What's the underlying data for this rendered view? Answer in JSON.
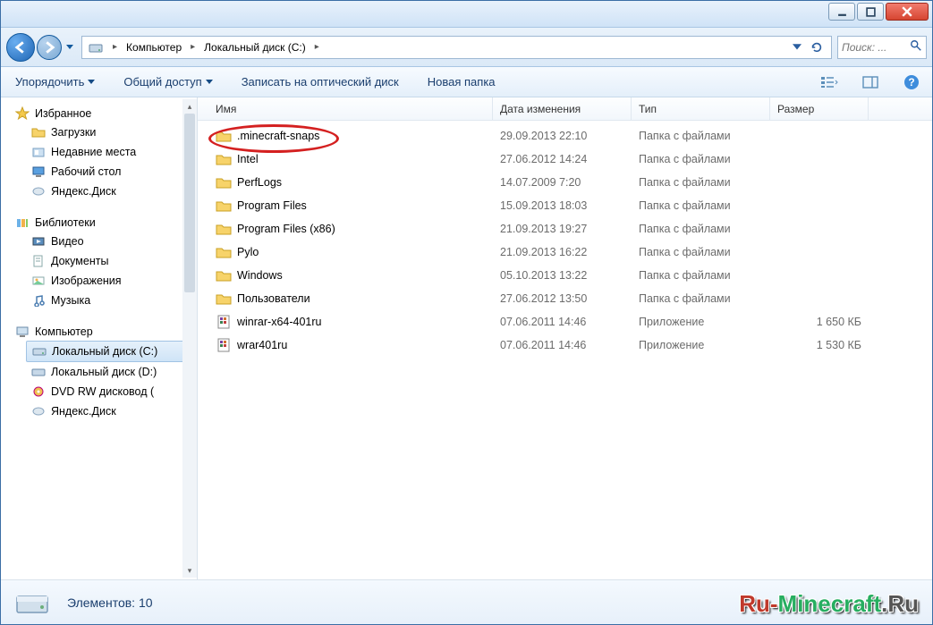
{
  "breadcrumbs": [
    "Компьютер",
    "Локальный диск (C:)"
  ],
  "search": {
    "placeholder": "Поиск: ..."
  },
  "toolbar": {
    "organize": "Упорядочить",
    "share": "Общий доступ",
    "burn": "Записать на оптический диск",
    "new_folder": "Новая папка"
  },
  "columns": {
    "name": "Имя",
    "date": "Дата изменения",
    "type": "Тип",
    "size": "Размер"
  },
  "sidebar": {
    "favorites": {
      "head": "Избранное",
      "items": [
        "Загрузки",
        "Недавние места",
        "Рабочий стол",
        "Яндекс.Диск"
      ]
    },
    "libraries": {
      "head": "Библиотеки",
      "items": [
        "Видео",
        "Документы",
        "Изображения",
        "Музыка"
      ]
    },
    "computer": {
      "head": "Компьютер",
      "items": [
        "Локальный диск (C:)",
        "Локальный диск (D:)",
        "DVD RW дисковод (",
        "Яндекс.Диск"
      ]
    }
  },
  "files": [
    {
      "name": ".minecraft-snaps",
      "date": "29.09.2013 22:10",
      "type": "Папка с файлами",
      "size": "",
      "kind": "folder",
      "highlight": true
    },
    {
      "name": "Intel",
      "date": "27.06.2012 14:24",
      "type": "Папка с файлами",
      "size": "",
      "kind": "folder"
    },
    {
      "name": "PerfLogs",
      "date": "14.07.2009 7:20",
      "type": "Папка с файлами",
      "size": "",
      "kind": "folder"
    },
    {
      "name": "Program Files",
      "date": "15.09.2013 18:03",
      "type": "Папка с файлами",
      "size": "",
      "kind": "folder"
    },
    {
      "name": "Program Files (x86)",
      "date": "21.09.2013 19:27",
      "type": "Папка с файлами",
      "size": "",
      "kind": "folder"
    },
    {
      "name": "Pylo",
      "date": "21.09.2013 16:22",
      "type": "Папка с файлами",
      "size": "",
      "kind": "folder"
    },
    {
      "name": "Windows",
      "date": "05.10.2013 13:22",
      "type": "Папка с файлами",
      "size": "",
      "kind": "folder"
    },
    {
      "name": "Пользователи",
      "date": "27.06.2012 13:50",
      "type": "Папка с файлами",
      "size": "",
      "kind": "folder"
    },
    {
      "name": "winrar-x64-401ru",
      "date": "07.06.2011 14:46",
      "type": "Приложение",
      "size": "1 650 КБ",
      "kind": "exe"
    },
    {
      "name": "wrar401ru",
      "date": "07.06.2011 14:46",
      "type": "Приложение",
      "size": "1 530 КБ",
      "kind": "exe"
    }
  ],
  "status": {
    "label": "Элементов:",
    "count": "10"
  },
  "watermark": {
    "p1": "Ru-",
    "p2": "Minecraft",
    "p3": ".Ru"
  }
}
